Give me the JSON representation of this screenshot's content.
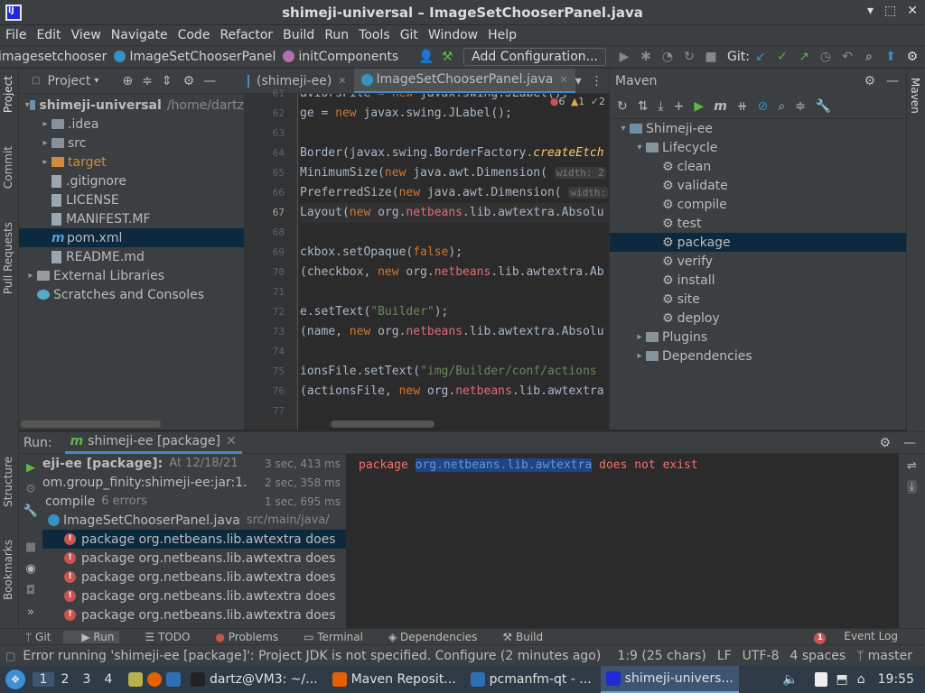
{
  "window": {
    "title": "shimeji-universal – ImageSetChooserPanel.java"
  },
  "menu": [
    "File",
    "Edit",
    "View",
    "Navigate",
    "Code",
    "Refactor",
    "Build",
    "Run",
    "Tools",
    "Git",
    "Window",
    "Help"
  ],
  "nav": {
    "crumbs": [
      "imagesetchooser",
      "ImageSetChooserPanel",
      "initComponents"
    ],
    "add_config": "Add Configuration...",
    "git_label": "Git:"
  },
  "left_strip": [
    "Project",
    "Commit",
    "Pull Requests",
    "Structure",
    "Bookmarks"
  ],
  "right_strip": [
    "Maven"
  ],
  "project": {
    "header": "Project",
    "rows": [
      {
        "label": "shimeji-universal",
        "extra": "/home/dartz",
        "kind": "module",
        "indent": 0,
        "arrow": "▾"
      },
      {
        "label": ".idea",
        "kind": "folder",
        "indent": 1,
        "arrow": "▸"
      },
      {
        "label": "src",
        "kind": "folder",
        "indent": 1,
        "arrow": "▸"
      },
      {
        "label": "target",
        "kind": "folder-orange",
        "indent": 1,
        "arrow": "▸"
      },
      {
        "label": ".gitignore",
        "kind": "file",
        "indent": 1,
        "arrow": ""
      },
      {
        "label": "LICENSE",
        "kind": "file",
        "indent": 1,
        "arrow": ""
      },
      {
        "label": "MANIFEST.MF",
        "kind": "file",
        "indent": 1,
        "arrow": ""
      },
      {
        "label": "pom.xml",
        "kind": "file-m",
        "indent": 1,
        "arrow": "",
        "selected": true
      },
      {
        "label": "README.md",
        "kind": "file",
        "indent": 1,
        "arrow": ""
      },
      {
        "label": "External Libraries",
        "kind": "lib",
        "indent": 0,
        "arrow": "▸"
      },
      {
        "label": "Scratches and Consoles",
        "kind": "scratch",
        "indent": 0,
        "arrow": ""
      }
    ]
  },
  "editor": {
    "tabs": [
      {
        "label": "(shimeji-ee)",
        "active": false
      },
      {
        "label": "ImageSetChooserPanel.java",
        "active": true
      }
    ],
    "warnings": {
      "errors": "6",
      "warn1": "1",
      "warn2": "2"
    },
    "line_numbers": [
      "61",
      "62",
      "63",
      "64",
      "65",
      "66",
      "67",
      "68",
      "69",
      "70",
      "71",
      "72",
      "73",
      "74",
      "75",
      "76",
      "77"
    ],
    "current_line": "67"
  },
  "maven": {
    "header": "Maven",
    "rows": [
      {
        "label": "Shimeji-ee",
        "indent": 0,
        "arrow": "▾",
        "kind": "module"
      },
      {
        "label": "Lifecycle",
        "indent": 1,
        "arrow": "▾",
        "kind": "folder"
      },
      {
        "label": "clean",
        "indent": 2,
        "arrow": "",
        "kind": "gear"
      },
      {
        "label": "validate",
        "indent": 2,
        "arrow": "",
        "kind": "gear"
      },
      {
        "label": "compile",
        "indent": 2,
        "arrow": "",
        "kind": "gear"
      },
      {
        "label": "test",
        "indent": 2,
        "arrow": "",
        "kind": "gear"
      },
      {
        "label": "package",
        "indent": 2,
        "arrow": "",
        "kind": "gear",
        "selected": true
      },
      {
        "label": "verify",
        "indent": 2,
        "arrow": "",
        "kind": "gear"
      },
      {
        "label": "install",
        "indent": 2,
        "arrow": "",
        "kind": "gear"
      },
      {
        "label": "site",
        "indent": 2,
        "arrow": "",
        "kind": "gear"
      },
      {
        "label": "deploy",
        "indent": 2,
        "arrow": "",
        "kind": "gear"
      },
      {
        "label": "Plugins",
        "indent": 1,
        "arrow": "▸",
        "kind": "folder"
      },
      {
        "label": "Dependencies",
        "indent": 1,
        "arrow": "▸",
        "kind": "folder"
      }
    ]
  },
  "run": {
    "label": "Run:",
    "tab": "shimeji-ee [package]",
    "rows": [
      {
        "label": "eji-ee [package]:",
        "extra": "At 12/18/21",
        "time": "3 sec, 413 ms",
        "bold": true,
        "indent": 0
      },
      {
        "label": "om.group_finity:shimeji-ee:jar:1.",
        "extra": "",
        "time": "2 sec, 358 ms",
        "indent": 0
      },
      {
        "label": "compile",
        "extra": "6 errors",
        "time": "1 sec, 695 ms",
        "indent": 1
      },
      {
        "label": "ImageSetChooserPanel.java",
        "extra": "src/main/java/",
        "time": "",
        "indent": 2,
        "file": true
      },
      {
        "label": "package org.netbeans.lib.awtextra does",
        "extra": "",
        "time": "",
        "indent": 3,
        "error": true,
        "selected": true
      },
      {
        "label": "package org.netbeans.lib.awtextra does",
        "extra": "",
        "time": "",
        "indent": 3,
        "error": true
      },
      {
        "label": "package org.netbeans.lib.awtextra does",
        "extra": "",
        "time": "",
        "indent": 3,
        "error": true
      },
      {
        "label": "package org.netbeans.lib.awtextra does",
        "extra": "",
        "time": "",
        "indent": 3,
        "error": true
      },
      {
        "label": "package org.netbeans.lib.awtextra does",
        "extra": "",
        "time": "",
        "indent": 3,
        "error": true
      }
    ],
    "console": {
      "prefix": "package ",
      "highlight": "org.netbeans.lib.awtextra",
      "suffix": " does not exist"
    }
  },
  "bottom_tabs": [
    "Git",
    "Run",
    "TODO",
    "Problems",
    "Terminal",
    "Dependencies",
    "Build"
  ],
  "event_log": {
    "count": "1",
    "label": "Event Log"
  },
  "status": {
    "message": "Error running 'shimeji-ee [package]': Project JDK is not specified. Configure (2 minutes ago)",
    "position": "1:9 (25 chars)",
    "line_sep": "LF",
    "encoding": "UTF-8",
    "indent": "4 spaces",
    "branch": "master"
  },
  "taskbar": {
    "workspaces": [
      "1",
      "2",
      "3",
      "4"
    ],
    "tasks": [
      {
        "label": "dartz@VM3: ~/...",
        "color": "#222"
      },
      {
        "label": "Maven Reposit...",
        "color": "#e66000"
      },
      {
        "label": "pcmanfm-qt - ...",
        "color": "#2f6fb5"
      },
      {
        "label": "shimeji-univers...",
        "color": "#1f2ad6",
        "active": true
      }
    ],
    "clock": "19:55"
  }
}
